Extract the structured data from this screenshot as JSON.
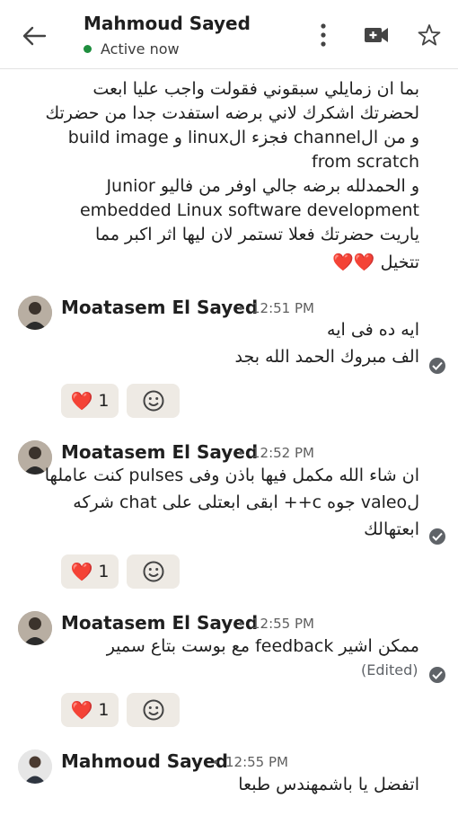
{
  "header": {
    "title": "Mahmoud Sayed",
    "status": "Active now",
    "status_color": "#1e8e3e"
  },
  "top_message": {
    "lines": [
      "بما ان زمايلي سبقوني فقولت واجب عليا ابعت",
      "لحضرتك اشكرك لاني برضه استفدت جدا من حضرتك",
      "و من الchannel فجزء الlinux و build image",
      "from scratch",
      "و الحمدلله برضه جالي اوفر من فاليو Junior",
      "embedded Linux software development",
      "ياريت حضرتك فعلا تستمر لان ليها اثر اكبر مما",
      "تتخيل ❤️❤️"
    ]
  },
  "messages": [
    {
      "sender": "Moatasem El Sayed",
      "time": "12:51 PM",
      "lines": [
        "ايه ده فى ايه",
        "الف مبروك الحمد الله بجد"
      ],
      "reaction_emoji": "❤️",
      "reaction_count": "1"
    },
    {
      "sender": "Moatasem El Sayed",
      "time": "12:52 PM",
      "lines": [
        "ان شاء الله مكمل فيها باذن وفى pulses كنت عاملها",
        "لvaleo جوه c++ ابقى ابعتلى على chat شركه",
        "ابعتهالك"
      ],
      "reaction_emoji": "❤️",
      "reaction_count": "1"
    },
    {
      "sender": "Moatasem El Sayed",
      "time": "12:55 PM",
      "lines": [
        "ممكن اشير feedback مع بوست بتاع سمير"
      ],
      "edited": "(Edited)",
      "reaction_emoji": "❤️",
      "reaction_count": "1"
    },
    {
      "sender": "Mahmoud Sayed",
      "time": "12:55 PM",
      "lines": [
        "اتفضل يا باشمهندس طبعا"
      ]
    }
  ],
  "separator": "•",
  "icons": {
    "back": "arrow-back-icon",
    "more": "more-vert-icon",
    "video": "video-call-icon",
    "star": "star-outline-icon",
    "add_reaction": "add-reaction-icon",
    "read": "read-receipt-icon"
  }
}
